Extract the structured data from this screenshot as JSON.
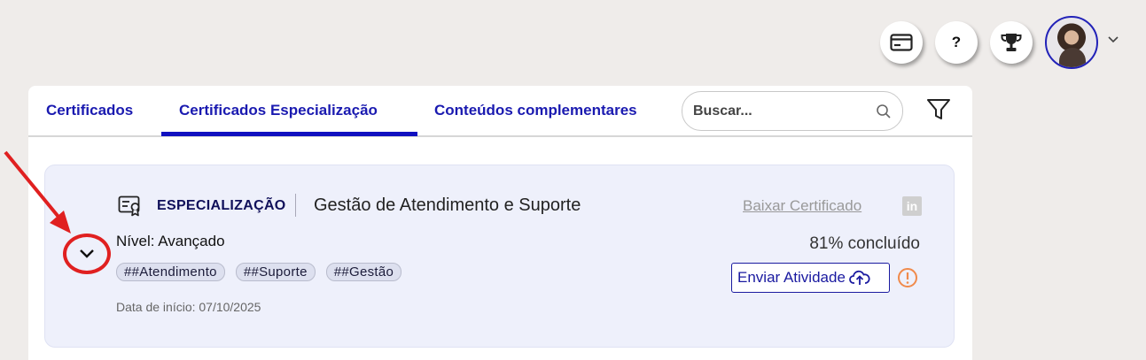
{
  "header": {
    "help_label": "?"
  },
  "tabs": [
    {
      "label": "Certificados"
    },
    {
      "label": "Certificados Especialização"
    },
    {
      "label": "Conteúdos complementares"
    }
  ],
  "search": {
    "placeholder": "Buscar..."
  },
  "card": {
    "type_label": "ESPECIALIZAÇÃO",
    "title": "Gestão de Atendimento e Suporte",
    "level": "Nível: Avançado",
    "tags": [
      "##Atendimento",
      "##Suporte",
      "##Gestão"
    ],
    "start_date": "Data de início: 07/10/2025",
    "download_label": "Baixar Certificado",
    "linkedin_label": "in",
    "progress": "81% concluído",
    "send_label": "Enviar Atividade"
  },
  "colors": {
    "accent": "#1010c0",
    "annotation": "#e02020",
    "warning": "#f08a4b"
  }
}
